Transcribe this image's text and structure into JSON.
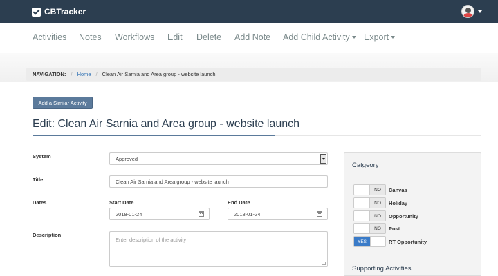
{
  "topbar": {
    "brand": "CBTracker",
    "brand_icon": "checkbox-icon",
    "user_icon": "avatar",
    "caret_icon": "caret-down-icon"
  },
  "menu": {
    "items": [
      "Activities",
      "Notes",
      "Workflows",
      "Edit",
      "Delete",
      "Add Note"
    ],
    "dropdowns": [
      "Add Child Activity",
      "Export"
    ]
  },
  "breadcrumb": {
    "label": "NAVIGATION:",
    "separator": "/",
    "home": "Home",
    "current": "Clean Air Sarnia and Area group - website launch"
  },
  "actions": {
    "add_similar": "Add a Similar Activity"
  },
  "page": {
    "title": "Edit: Clean Air Sarnia and Area group - website launch"
  },
  "form": {
    "system": {
      "label": "System",
      "value": "Approved"
    },
    "title": {
      "label": "Title",
      "value": "Clean Air Sarnia and Area group - website launch"
    },
    "dates": {
      "label": "Dates",
      "start_label": "Start Date",
      "start_value": "2018-01-24",
      "end_label": "End Date",
      "end_value": "2018-01-24",
      "icon": "calendar-icon"
    },
    "description": {
      "label": "Description",
      "placeholder": "Enter description of the activity"
    }
  },
  "category": {
    "title": "Catgeory",
    "items": [
      {
        "label": "Canvas",
        "on": false,
        "state_text": "NO"
      },
      {
        "label": "Holiday",
        "on": false,
        "state_text": "NO"
      },
      {
        "label": "Opportunity",
        "on": false,
        "state_text": "NO"
      },
      {
        "label": "Post",
        "on": false,
        "state_text": "NO"
      },
      {
        "label": "RT Opportunity",
        "on": true,
        "state_text": "YES"
      }
    ],
    "supporting_title": "Supporting Activities"
  },
  "colors": {
    "topbar": "#2c3e50",
    "button": "#5b7a9b",
    "toggle_on": "#3a7bc8",
    "link": "#2c6fb3"
  }
}
